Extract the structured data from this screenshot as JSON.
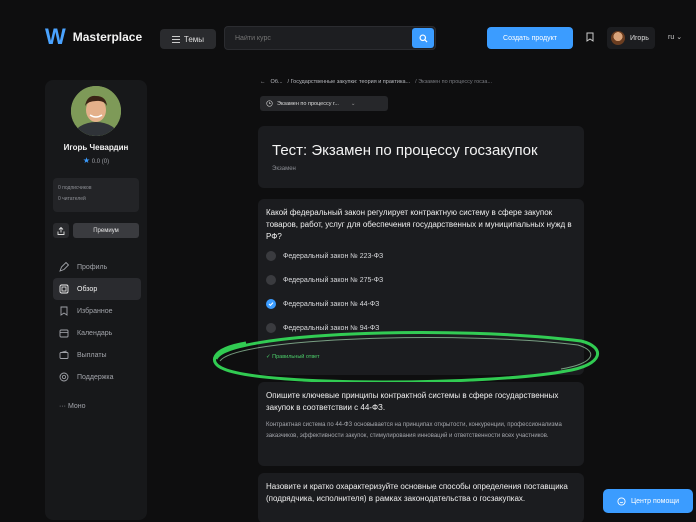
{
  "topbar": {
    "logo_mark": "W",
    "logo_text": "Masterplace",
    "themes_label": "Темы",
    "search_placeholder": "Найти курс",
    "create_label": "Создать продукт",
    "user_name": "Игорь",
    "lang": "ru"
  },
  "sidebar": {
    "name": "Игорь Чевардин",
    "rating": "0.0",
    "rating_count": "(0)",
    "subscribers": "0 подписчиков",
    "readers": "0 читателей",
    "primary_label": "Премиум",
    "nav": [
      {
        "label": "Профиль",
        "icon": "pencil-icon"
      },
      {
        "label": "Обзор",
        "icon": "overview-icon",
        "active": true
      },
      {
        "label": "Избранное",
        "icon": "bookmark-icon"
      },
      {
        "label": "Календарь",
        "icon": "calendar-icon"
      },
      {
        "label": "Выплаты",
        "icon": "wallet-icon"
      },
      {
        "label": "Поддержка",
        "icon": "support-icon"
      }
    ],
    "more_label": "··· Моно"
  },
  "main": {
    "breadcrumb_1": "Об...",
    "breadcrumb_2": "/ Государственные закупки: теория и практика...",
    "breadcrumb_3": "/ Экзамен по процессу госза...",
    "exam_select": "Экзамен по процессу г...",
    "title": "Тест: Экзамен по процессу госзакупок",
    "subtitle": "Экзамен",
    "q1": {
      "text": "Какой федеральный закон регулирует контрактную систему в сфере закупок товаров, работ, услуг для обеспечения государственных и муниципальных нужд в РФ?",
      "options": [
        "Федеральный закон № 223-ФЗ",
        "Федеральный закон № 275-ФЗ",
        "Федеральный закон № 44-ФЗ",
        "Федеральный закон № 94-ФЗ"
      ],
      "correct_label": "✓ Правильный ответ"
    },
    "q2": {
      "text": "Опишите ключевые принципы контрактной системы в сфере государственных закупок в соответствии с 44-ФЗ.",
      "answer": "Контрактная система по 44-ФЗ основывается на принципах открытости, конкуренции, профессионализма заказчиков, эффективности закупок, стимулирования инноваций и ответственности всех участников."
    },
    "q3": {
      "text": "Назовите и кратко охарактеризуйте основные способы определения поставщика (подрядчика, исполнителя) в рамках законодательства о госзакупках."
    }
  },
  "help_label": "Центр помощи",
  "colors": {
    "accent": "#3b9cff",
    "correct": "#4ccf6a",
    "highlight": "#35e05a"
  }
}
